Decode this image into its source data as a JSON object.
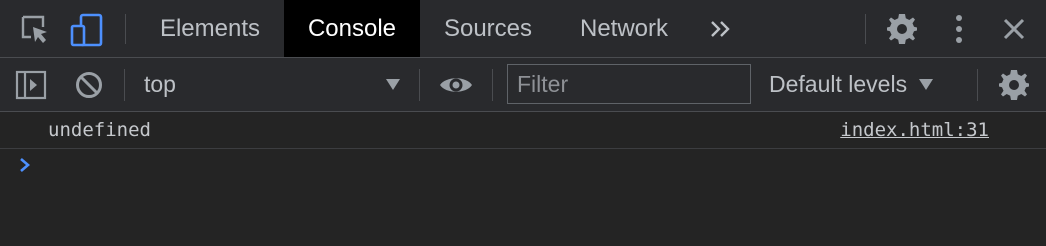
{
  "tabs": [
    {
      "label": "Elements",
      "active": false
    },
    {
      "label": "Console",
      "active": true
    },
    {
      "label": "Sources",
      "active": false
    },
    {
      "label": "Network",
      "active": false
    }
  ],
  "tabbar": {
    "more_tabs_icon": "double-chevron-right-icon",
    "settings_icon": "gear-icon",
    "menu_icon": "vertical-dots-icon",
    "close_icon": "close-icon",
    "inspect_icon": "element-picker-icon",
    "device_icon": "device-toolbar-icon"
  },
  "toolbar": {
    "context": "top",
    "filter_placeholder": "Filter",
    "filter_value": "",
    "levels": "Default levels",
    "sidebar_icon": "show-sidebar-icon",
    "clear_icon": "clear-console-icon",
    "live_expression_icon": "eye-icon",
    "settings_icon": "gear-icon"
  },
  "console": {
    "messages": [
      {
        "text": "undefined",
        "source": "index.html:31"
      }
    ],
    "prompt_symbol": "›"
  },
  "colors": {
    "accent": "#4d90fe",
    "panel_bg": "#292a2d",
    "body_bg": "#242424",
    "active_tab_bg": "#000000"
  }
}
